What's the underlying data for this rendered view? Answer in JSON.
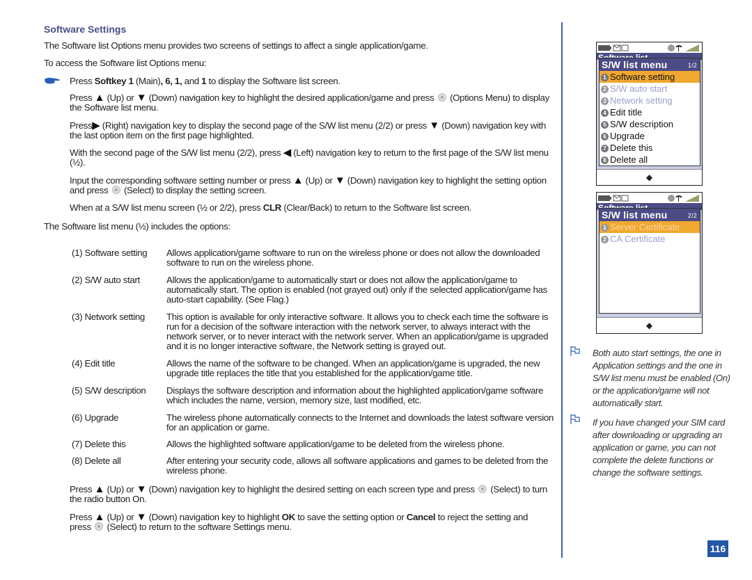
{
  "heading": "Software Settings",
  "intro": "The Software list Options menu provides two screens of settings to affect a single application/game.",
  "access": "To access the Software list Options menu:",
  "step1": {
    "press": "Press ",
    "softkey": "Softkey 1",
    "main": " (Main)",
    "keys": ", 6, 1,",
    "and": " and ",
    "one": "1",
    "rest": " to display the Software list screen."
  },
  "para_options_menu": {
    "a": "Press ",
    "up": "(Up) or ",
    "down": "(Down) navigation key to highlight the desired application/game and press ",
    "b": "(Options Menu) to display the Software list menu."
  },
  "para_right": {
    "a": "Press",
    "b": "(Right) navigation key to display the second page of the S/W list menu (2/2) or press ",
    "c": "(Down) navigation key with the last option item on the first page highlighted."
  },
  "para_left": {
    "a": "With the second page of the S/W list menu (2/2), press ",
    "b": "(Left) navigation key to return to the first page of the S/W list menu (½)."
  },
  "para_input": {
    "a": "Input the corresponding software setting number or press ",
    "b": "(Up) or ",
    "c": "(Down) navigation key to highlight the setting option and press ",
    "d": "(Select) to display the setting screen."
  },
  "para_clr": {
    "a": "When at a S/W list menu screen (½ or 2/2), press ",
    "clr": "CLR",
    "b": " (Clear/Back) to return to the Software list screen."
  },
  "options_intro": "The Software list menu (½) includes the options:",
  "options": [
    {
      "label": "(1) Software setting",
      "desc": "Allows application/game software to run on the wireless phone or does not allow the downloaded software to run on the wireless phone."
    },
    {
      "label": "(2) S/W auto start",
      "desc": "Allows the application/game to automatically start or does not allow the application/game to automatically start. The option is enabled (not grayed out) only if the selected application/game has auto-start capability. (See Flag.)"
    },
    {
      "label": "(3) Network setting",
      "desc": "This option is available for only interactive software. It allows you to check each time the software is run for a decision of the software interaction with the network server, to always interact with the network server, or to never interact with the network server. When an application/game is upgraded and it is no longer interactive software, the Network setting is grayed out."
    },
    {
      "label": "(4) Edit title",
      "desc": "Allows the name of the software to be changed. When an application/game is upgraded, the new upgrade title replaces the title that you established for the application/game title."
    },
    {
      "label": "(5) S/W description",
      "desc": "Displays the software description and information about the highlighted application/game software which includes the name, version, memory size, last modified, etc."
    },
    {
      "label": "(6) Upgrade",
      "desc": "The wireless phone automatically connects to the Internet and downloads the latest software version for an application or game."
    },
    {
      "label": "(7) Delete this",
      "desc": "Allows the highlighted software application/game to be deleted from the wireless phone."
    },
    {
      "label": "(8) Delete all",
      "desc": "After entering your security code, allows all software applications and games to be deleted from the wireless phone."
    }
  ],
  "para_radio": {
    "a": "Press ",
    "b": "(Up) or ",
    "c": "(Down) navigation key to highlight the desired setting on each screen type and press ",
    "d": "(Select) to turn the radio button On."
  },
  "para_ok": {
    "a": "Press ",
    "b": "(Up) or ",
    "c": "(Down) navigation key to highlight ",
    "ok": "OK",
    "d": " to save the setting option or ",
    "cancel": "Cancel",
    "e": " to reject the setting and press ",
    "f": "(Select) to return to the software Settings menu."
  },
  "screen1": {
    "bg_title": "Software list",
    "menu_title": "S/W list menu",
    "page": "1/2",
    "items": [
      {
        "n": "1",
        "label": "Software setting",
        "state": "selected"
      },
      {
        "n": "2",
        "label": "S/W auto start",
        "state": "disabled"
      },
      {
        "n": "3",
        "label": "Network setting",
        "state": "disabled"
      },
      {
        "n": "4",
        "label": "Edit title",
        "state": "normal"
      },
      {
        "n": "5",
        "label": "S/W description",
        "state": "normal"
      },
      {
        "n": "6",
        "label": "Upgrade",
        "state": "normal"
      },
      {
        "n": "7",
        "label": "Delete this",
        "state": "normal"
      },
      {
        "n": "8",
        "label": "Delete all",
        "state": "normal"
      }
    ],
    "nav_icon": "four-way-navigation-icon"
  },
  "screen2": {
    "bg_title": "Software list",
    "menu_title": "S/W list menu",
    "page": "2/2",
    "items": [
      {
        "n": "1",
        "label": "Server Certificate",
        "state": "selected-disabled"
      },
      {
        "n": "2",
        "label": "CA Certificate",
        "state": "disabled"
      }
    ],
    "nav_icon": "four-way-navigation-icon"
  },
  "notes": [
    "Both auto start settings, the one in Application settings and the one in S/W list menu must be enabled (On) or the application/game will not automatically start.",
    "If you have changed your SIM card after downloading or upgrading an application or game, you can not complete the delete functions or change the software settings."
  ],
  "symbols": {
    "up": "▲",
    "down": "▼",
    "right": "▶",
    "left": "◀",
    "nav": "◆"
  },
  "page_number": "116",
  "colors": {
    "heading": "#4a4f86",
    "accent": "#2457a4",
    "highlight": "#f0a830",
    "menu_bar": "#4b4b85"
  }
}
